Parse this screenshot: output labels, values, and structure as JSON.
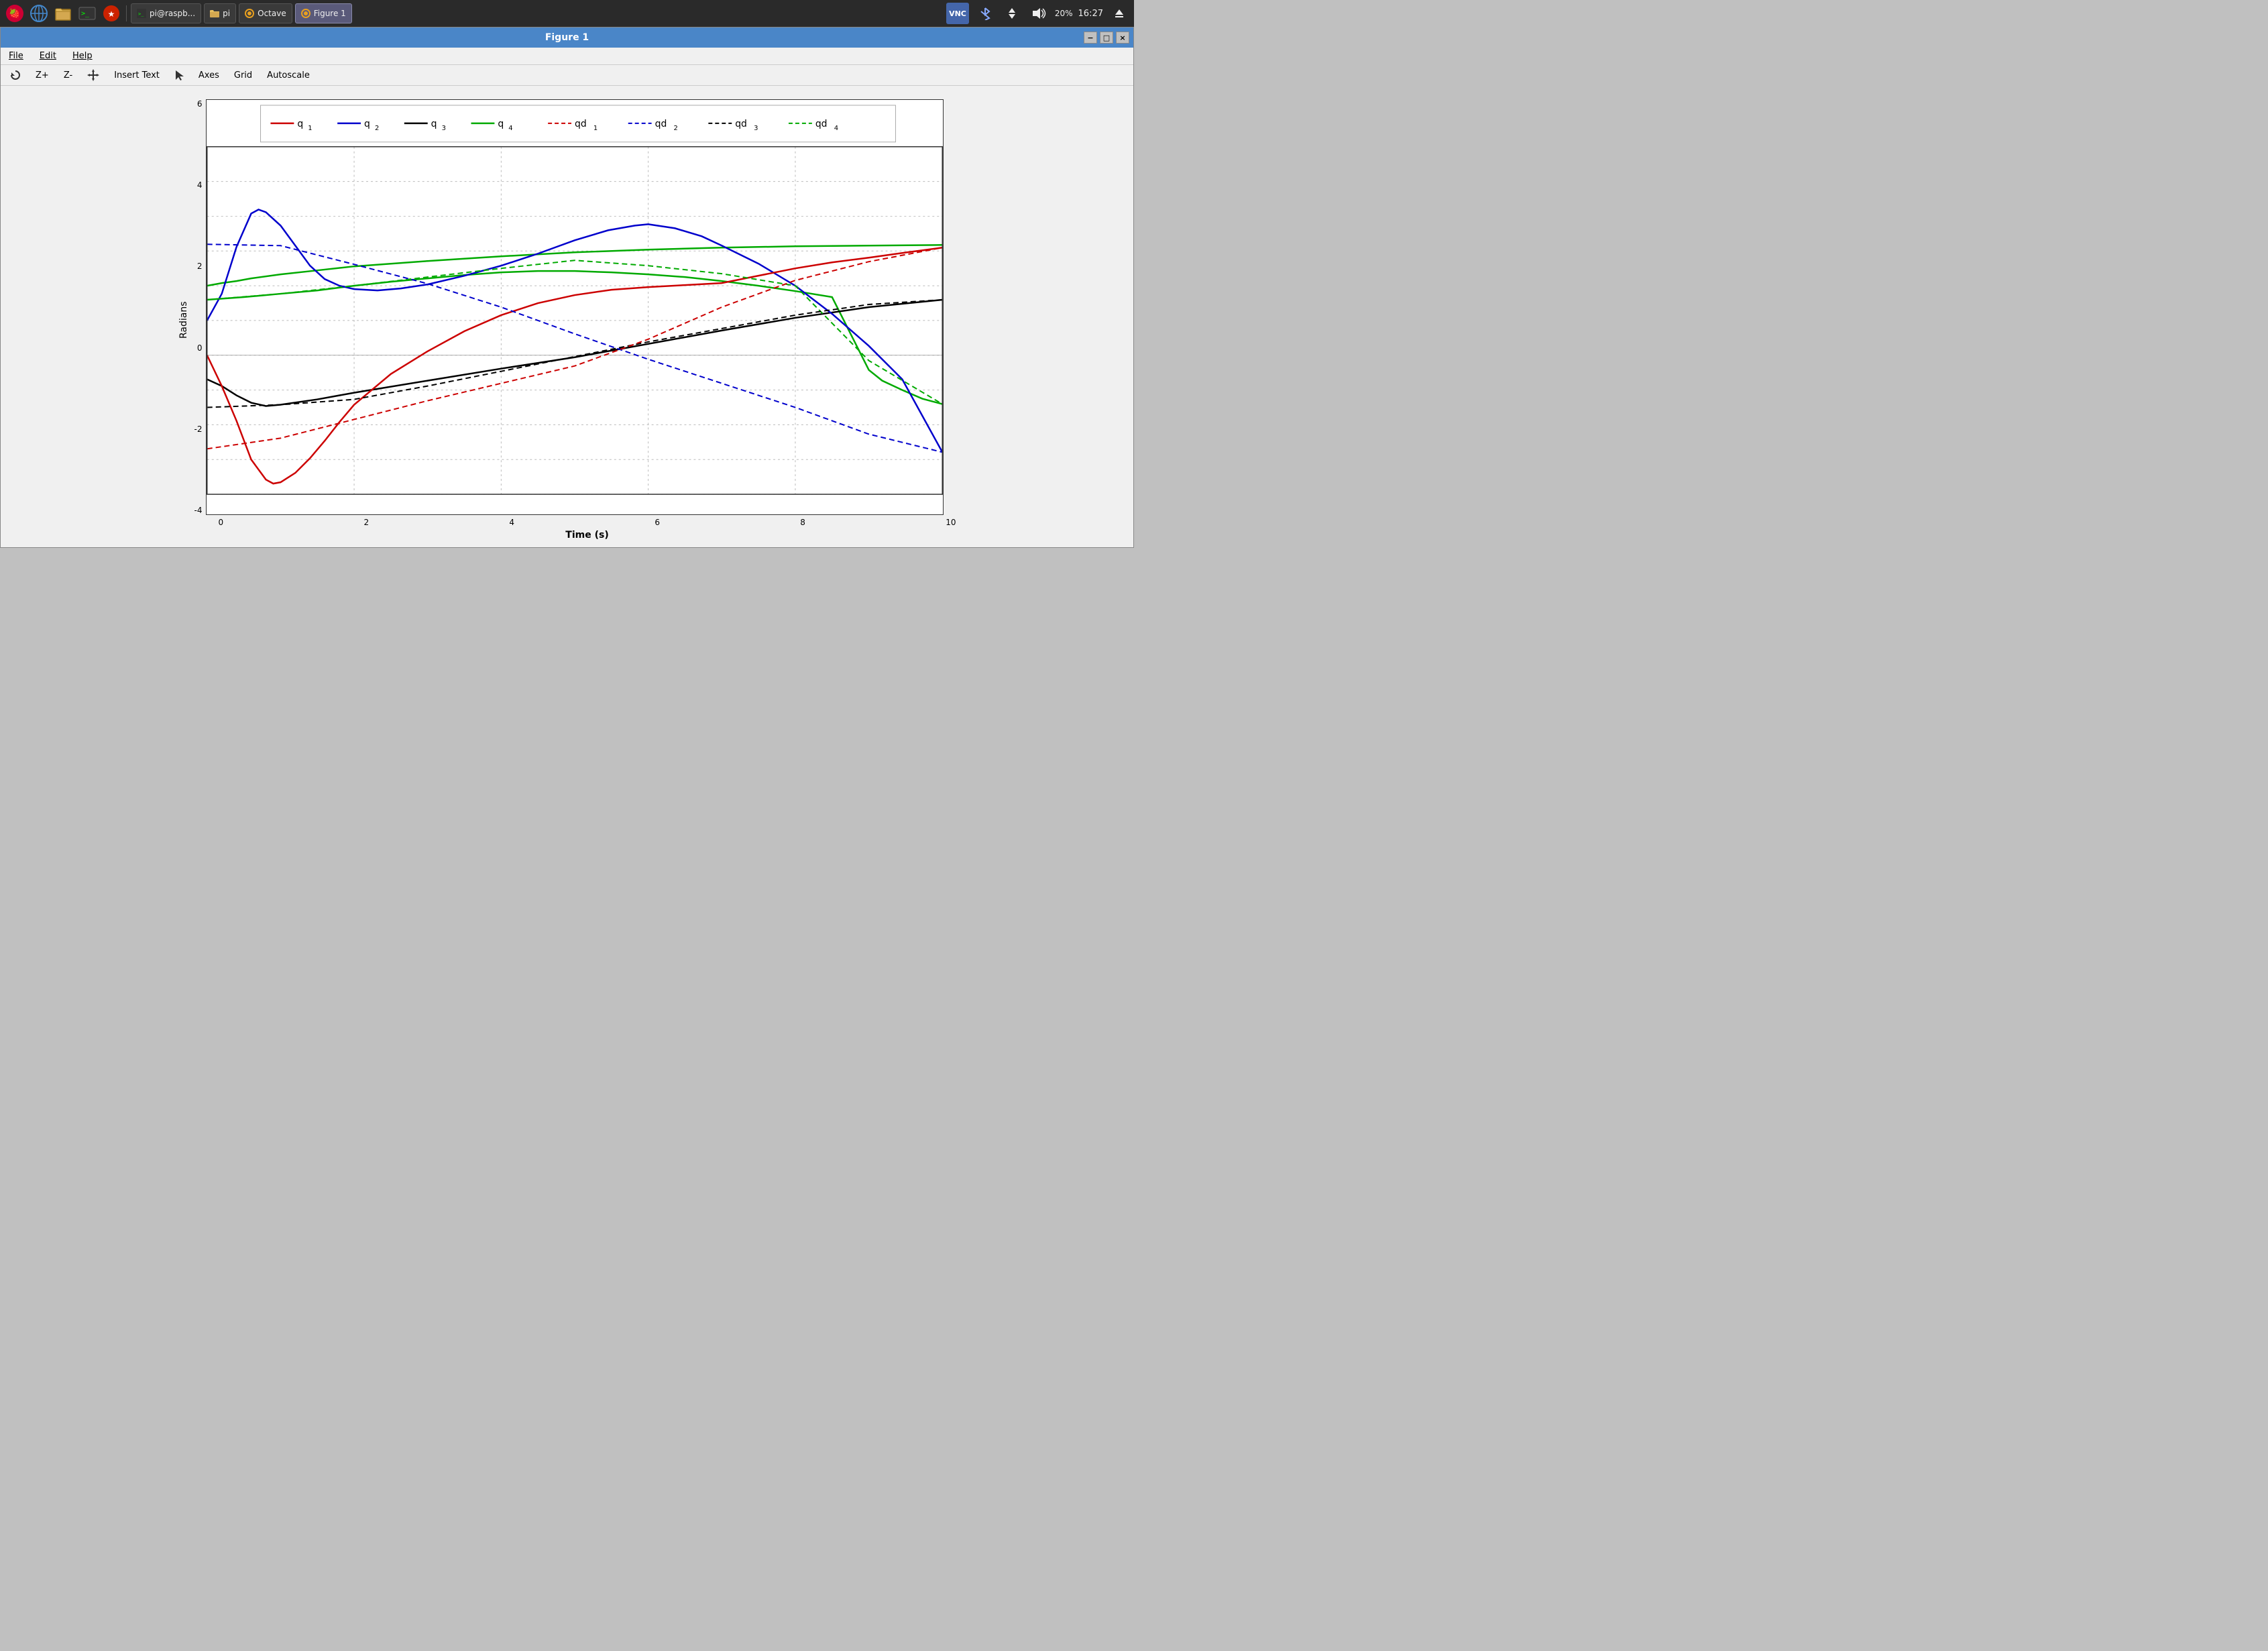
{
  "taskbar": {
    "apps": [
      {
        "label": "pi@raspb...",
        "icon": "terminal",
        "active": false
      },
      {
        "label": "pi",
        "icon": "folder",
        "active": false
      },
      {
        "label": "Octave",
        "icon": "octave",
        "active": false
      },
      {
        "label": "Figure 1",
        "icon": "figure",
        "active": true
      }
    ],
    "time": "16:27",
    "battery": "20%"
  },
  "window": {
    "title": "Figure 1",
    "menu": [
      "File",
      "Edit",
      "Help"
    ],
    "toolbar": [
      "Z+",
      "Z-",
      "Insert Text",
      "Axes",
      "Grid",
      "Autoscale"
    ]
  },
  "plot": {
    "title": "",
    "xlabel": "Time (s)",
    "ylabel": "Radians",
    "x_ticks": [
      "0",
      "2",
      "4",
      "6",
      "8",
      "10"
    ],
    "y_ticks": [
      "6",
      "4",
      "2",
      "0",
      "-2",
      "-4"
    ],
    "legend": [
      {
        "label": "q",
        "sub": "1",
        "color": "#cc0000",
        "dashed": false
      },
      {
        "label": "q",
        "sub": "2",
        "color": "#0000cc",
        "dashed": false
      },
      {
        "label": "q",
        "sub": "3",
        "color": "#000000",
        "dashed": false
      },
      {
        "label": "q",
        "sub": "4",
        "color": "#00aa00",
        "dashed": false
      },
      {
        "label": "qd",
        "sub": "1",
        "color": "#cc0000",
        "dashed": true
      },
      {
        "label": "qd",
        "sub": "2",
        "color": "#0000cc",
        "dashed": true
      },
      {
        "label": "qd",
        "sub": "3",
        "color": "#000000",
        "dashed": true
      },
      {
        "label": "qd",
        "sub": "4",
        "color": "#00aa00",
        "dashed": true
      }
    ]
  }
}
